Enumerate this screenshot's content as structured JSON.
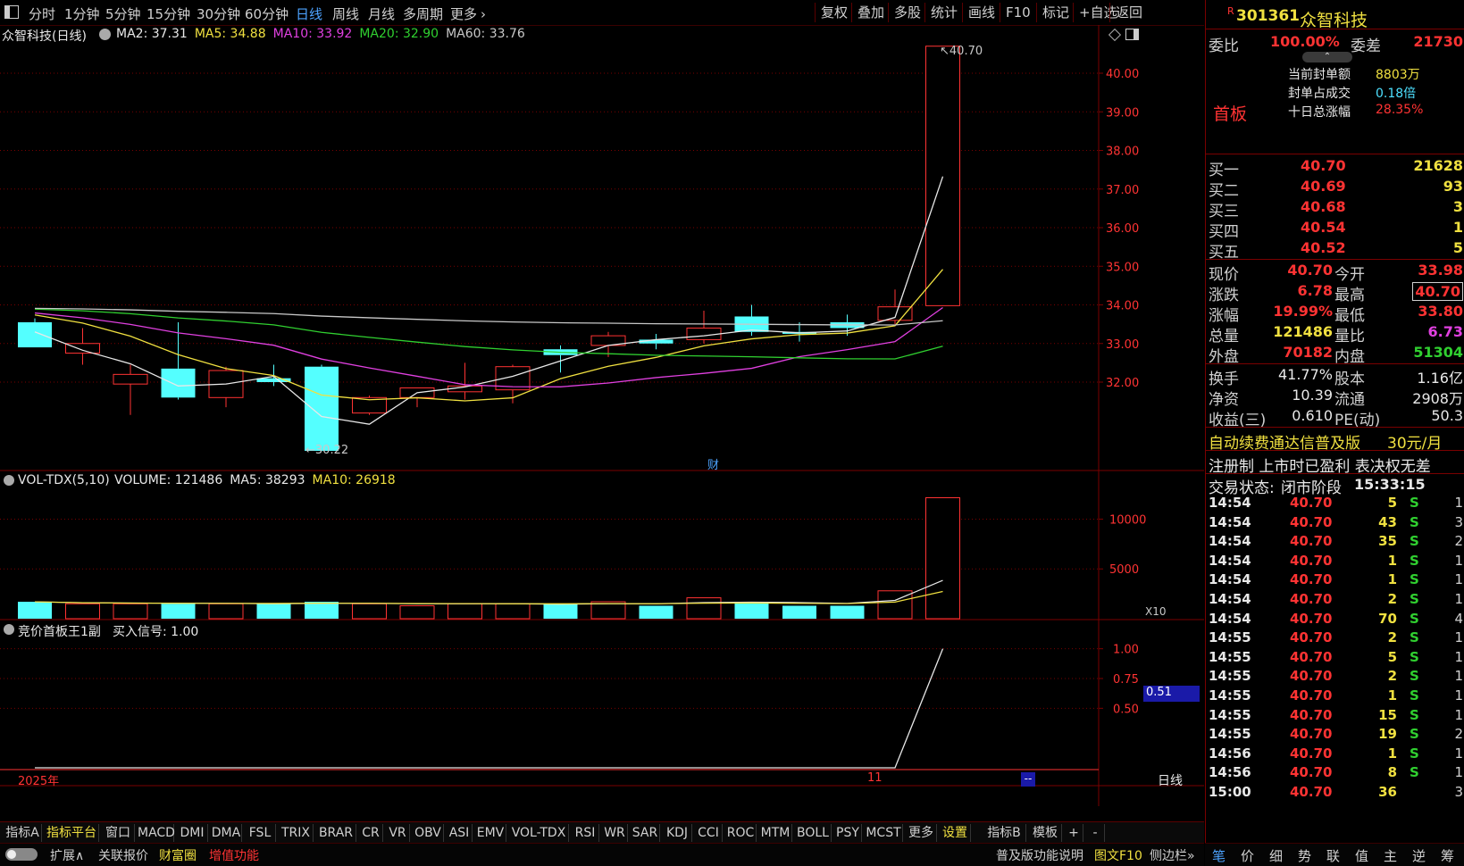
{
  "toolbar": {
    "timeframes": [
      "分时",
      "1分钟",
      "5分钟",
      "15分钟",
      "30分钟",
      "60分钟",
      "日线",
      "周线",
      "月线",
      "多周期",
      "更多"
    ],
    "active_timeframe": "日线",
    "right_buttons": [
      "复权",
      "叠加",
      "多股",
      "统计",
      "画线",
      "F10",
      "标记",
      "+自选",
      "返回"
    ]
  },
  "main_chart": {
    "title": "众智科技(日线)",
    "ma_labels": [
      {
        "text": "MA2: 37.31",
        "color": "#e8e8e8"
      },
      {
        "text": "MA5: 34.88",
        "color": "#f0e040"
      },
      {
        "text": "MA10: 33.92",
        "color": "#e040e0"
      },
      {
        "text": "MA20: 32.90",
        "color": "#30d030"
      },
      {
        "text": "MA60: 33.76",
        "color": "#c8c8c8"
      }
    ],
    "y_ticks": [
      "40.00",
      "39.00",
      "38.00",
      "37.00",
      "36.00",
      "35.00",
      "34.00",
      "33.00",
      "32.00"
    ],
    "high_label": "40.70",
    "low_label": "30.22",
    "marker": "财"
  },
  "volume_chart": {
    "title": "VOL-TDX(5,10)",
    "labels": [
      {
        "text": "VOLUME: 121486",
        "color": "#e8e8e8"
      },
      {
        "text": "MA5: 38293",
        "color": "#e8e8e8"
      },
      {
        "text": "MA10: 26918",
        "color": "#f0e040"
      }
    ],
    "y_ticks": [
      "10000",
      "5000"
    ],
    "unit": "X10"
  },
  "indicator_chart": {
    "title": "竞价首板王1副",
    "label": "买入信号: 1.00",
    "y_ticks": [
      "1.00",
      "0.75",
      "0.50"
    ],
    "current": "0.51",
    "year_label": "2025年",
    "month_label": "11",
    "period_label": "日线",
    "nav_marker": "--"
  },
  "chart_data": [
    {
      "type": "candlestick",
      "title": "众智科技(日线)",
      "ylim": [
        30.0,
        40.8
      ],
      "series": [
        {
          "o": 33.55,
          "h": 33.65,
          "l": 32.9,
          "c": 32.9,
          "color": "cyan"
        },
        {
          "o": 33.0,
          "h": 33.4,
          "l": 32.45,
          "c": 32.75,
          "color": "red"
        },
        {
          "o": 31.95,
          "h": 32.45,
          "l": 31.15,
          "c": 32.2,
          "color": "red"
        },
        {
          "o": 32.35,
          "h": 33.55,
          "l": 31.55,
          "c": 31.6,
          "color": "cyan"
        },
        {
          "o": 31.6,
          "h": 32.4,
          "l": 31.35,
          "c": 32.3,
          "color": "red"
        },
        {
          "o": 32.1,
          "h": 32.45,
          "l": 31.9,
          "c": 32.0,
          "color": "cyan"
        },
        {
          "o": 32.4,
          "h": 32.45,
          "l": 30.22,
          "c": 30.22,
          "color": "cyan"
        },
        {
          "o": 31.2,
          "h": 31.65,
          "l": 31.15,
          "c": 31.6,
          "color": "red"
        },
        {
          "o": 31.6,
          "h": 31.85,
          "l": 31.35,
          "c": 31.85,
          "color": "red"
        },
        {
          "o": 31.75,
          "h": 32.5,
          "l": 31.55,
          "c": 31.9,
          "color": "red"
        },
        {
          "o": 31.8,
          "h": 32.45,
          "l": 31.45,
          "c": 32.4,
          "color": "red"
        },
        {
          "o": 32.85,
          "h": 32.95,
          "l": 32.25,
          "c": 32.7,
          "color": "cyan"
        },
        {
          "o": 32.95,
          "h": 33.3,
          "l": 32.65,
          "c": 33.2,
          "color": "red"
        },
        {
          "o": 33.1,
          "h": 33.25,
          "l": 32.85,
          "c": 33.0,
          "color": "cyan"
        },
        {
          "o": 33.1,
          "h": 33.85,
          "l": 33.0,
          "c": 33.4,
          "color": "red"
        },
        {
          "o": 33.7,
          "h": 34.0,
          "l": 33.2,
          "c": 33.3,
          "color": "cyan"
        },
        {
          "o": 33.3,
          "h": 33.55,
          "l": 33.05,
          "c": 33.25,
          "color": "cyan"
        },
        {
          "o": 33.55,
          "h": 33.75,
          "l": 33.2,
          "c": 33.4,
          "color": "cyan"
        },
        {
          "o": 33.6,
          "h": 34.4,
          "l": 33.5,
          "c": 33.95,
          "color": "red"
        },
        {
          "o": 33.98,
          "h": 40.7,
          "l": 33.98,
          "c": 40.7,
          "color": "red"
        }
      ]
    },
    {
      "type": "bar",
      "title": "VOL-TDX(5,10)",
      "ylim": [
        0,
        13000
      ],
      "values": [
        1700,
        1500,
        1500,
        1500,
        1500,
        1500,
        1700,
        1500,
        1300,
        1500,
        1500,
        1500,
        1700,
        1300,
        2100,
        1700,
        1300,
        1300,
        2800,
        12148
      ],
      "colors": [
        "cyan",
        "red",
        "red",
        "cyan",
        "red",
        "cyan",
        "cyan",
        "red",
        "red",
        "red",
        "red",
        "cyan",
        "red",
        "cyan",
        "red",
        "cyan",
        "cyan",
        "cyan",
        "red",
        "red"
      ]
    },
    {
      "type": "line",
      "title": "竞价首板王1副",
      "ylim": [
        0,
        1.05
      ],
      "values": [
        0,
        0,
        0,
        0,
        0,
        0,
        0,
        0,
        0,
        0,
        0,
        0,
        0,
        0,
        0,
        0,
        0,
        0,
        0,
        1.0
      ]
    }
  ],
  "quote": {
    "code": "301361",
    "name": "众智科技",
    "r_mark": "R",
    "weibi_label": "委比",
    "weibi_value": "100.00%",
    "weicha_label": "委差",
    "weicha_value": "21730",
    "first_board": "首板",
    "stats": [
      {
        "label": "当前封单额",
        "value": "8803万"
      },
      {
        "label": "封单占成交",
        "value": "0.18倍"
      },
      {
        "label": "十日总涨幅",
        "value": "28.35%"
      }
    ],
    "bids": [
      {
        "label": "买一",
        "price": "40.70",
        "vol": "21628"
      },
      {
        "label": "买二",
        "price": "40.69",
        "vol": "93"
      },
      {
        "label": "买三",
        "price": "40.68",
        "vol": "3"
      },
      {
        "label": "买四",
        "price": "40.54",
        "vol": "1"
      },
      {
        "label": "买五",
        "price": "40.52",
        "vol": "5"
      }
    ],
    "info": [
      {
        "l1": "现价",
        "v1": "40.70",
        "l2": "今开",
        "v2": "33.98",
        "c2": "#ff3333"
      },
      {
        "l1": "涨跌",
        "v1": "6.78",
        "l2": "最高",
        "v2": "40.70",
        "c2": "#ff3333"
      },
      {
        "l1": "涨幅",
        "v1": "19.99%",
        "l2": "最低",
        "v2": "33.80",
        "c2": "#ff3333"
      },
      {
        "l1": "总量",
        "v1": "121486",
        "l2": "量比",
        "v2": "6.73",
        "c2": "#e040e0"
      },
      {
        "l1": "外盘",
        "v1": "70182",
        "l2": "内盘",
        "v2": "51304",
        "c2": "#30d030"
      }
    ],
    "info2": [
      {
        "l1": "换手",
        "v1": "41.77%",
        "l2": "股本",
        "v2": "1.16亿"
      },
      {
        "l1": "净资",
        "v1": "10.39",
        "l2": "流通",
        "v2": "2908万"
      },
      {
        "l1": "收益(三)",
        "v1": "0.610",
        "l2": "PE(动)",
        "v2": "50.3"
      }
    ],
    "promo": "自动续费通达信普及版",
    "promo_price": "30元/月",
    "notice": "注册制 上市时已盈利 表决权无差",
    "status_label": "交易状态:",
    "status_value": "闭市阶段",
    "status_time": "15:33:15",
    "ticks": [
      {
        "t": "14:54",
        "p": "40.70",
        "v": "5",
        "s": "S",
        "n": "1"
      },
      {
        "t": "14:54",
        "p": "40.70",
        "v": "43",
        "s": "S",
        "n": "3"
      },
      {
        "t": "14:54",
        "p": "40.70",
        "v": "35",
        "s": "S",
        "n": "2"
      },
      {
        "t": "14:54",
        "p": "40.70",
        "v": "1",
        "s": "S",
        "n": "1"
      },
      {
        "t": "14:54",
        "p": "40.70",
        "v": "1",
        "s": "S",
        "n": "1"
      },
      {
        "t": "14:54",
        "p": "40.70",
        "v": "2",
        "s": "S",
        "n": "1"
      },
      {
        "t": "14:54",
        "p": "40.70",
        "v": "70",
        "s": "S",
        "n": "4"
      },
      {
        "t": "14:55",
        "p": "40.70",
        "v": "2",
        "s": "S",
        "n": "1"
      },
      {
        "t": "14:55",
        "p": "40.70",
        "v": "5",
        "s": "S",
        "n": "1"
      },
      {
        "t": "14:55",
        "p": "40.70",
        "v": "2",
        "s": "S",
        "n": "1"
      },
      {
        "t": "14:55",
        "p": "40.70",
        "v": "1",
        "s": "S",
        "n": "1"
      },
      {
        "t": "14:55",
        "p": "40.70",
        "v": "15",
        "s": "S",
        "n": "1"
      },
      {
        "t": "14:55",
        "p": "40.70",
        "v": "19",
        "s": "S",
        "n": "2"
      },
      {
        "t": "14:56",
        "p": "40.70",
        "v": "1",
        "s": "S",
        "n": "1"
      },
      {
        "t": "14:56",
        "p": "40.70",
        "v": "8",
        "s": "S",
        "n": "1"
      },
      {
        "t": "15:00",
        "p": "40.70",
        "v": "36",
        "s": "",
        "n": "3"
      }
    ],
    "bottom_tabs": [
      "笔",
      "价",
      "细",
      "势",
      "联",
      "值",
      "主",
      "逆",
      "筹"
    ]
  },
  "indicator_tabs": [
    "指标A",
    "指标平台",
    "窗口",
    "MACD",
    "DMI",
    "DMA",
    "FSL",
    "TRIX",
    "BRAR",
    "CR",
    "VR",
    "OBV",
    "ASI",
    "EMV",
    "VOL-TDX",
    "RSI",
    "WR",
    "SAR",
    "KDJ",
    "CCI",
    "ROC",
    "MTM",
    "BOLL",
    "PSY",
    "MCST",
    "更多",
    "设置",
    "指标B",
    "模板",
    "+",
    "-"
  ],
  "bottom_bar": {
    "items": [
      {
        "text": "扩展∧",
        "color": "#d0d0d0"
      },
      {
        "text": "关联报价",
        "color": "#d0d0d0"
      },
      {
        "text": "财富圈",
        "color": "#f0e040"
      },
      {
        "text": "增值功能",
        "color": "#ff3333"
      }
    ],
    "right_items": [
      {
        "text": "普及版功能说明",
        "color": "#d0d0d0"
      },
      {
        "text": "图文F10",
        "color": "#f0e040"
      },
      {
        "text": "侧边栏»",
        "color": "#d0d0d0"
      }
    ]
  },
  "colors": {
    "up": "#ff3333",
    "down": "#54ffff",
    "grid": "#7a0000"
  }
}
